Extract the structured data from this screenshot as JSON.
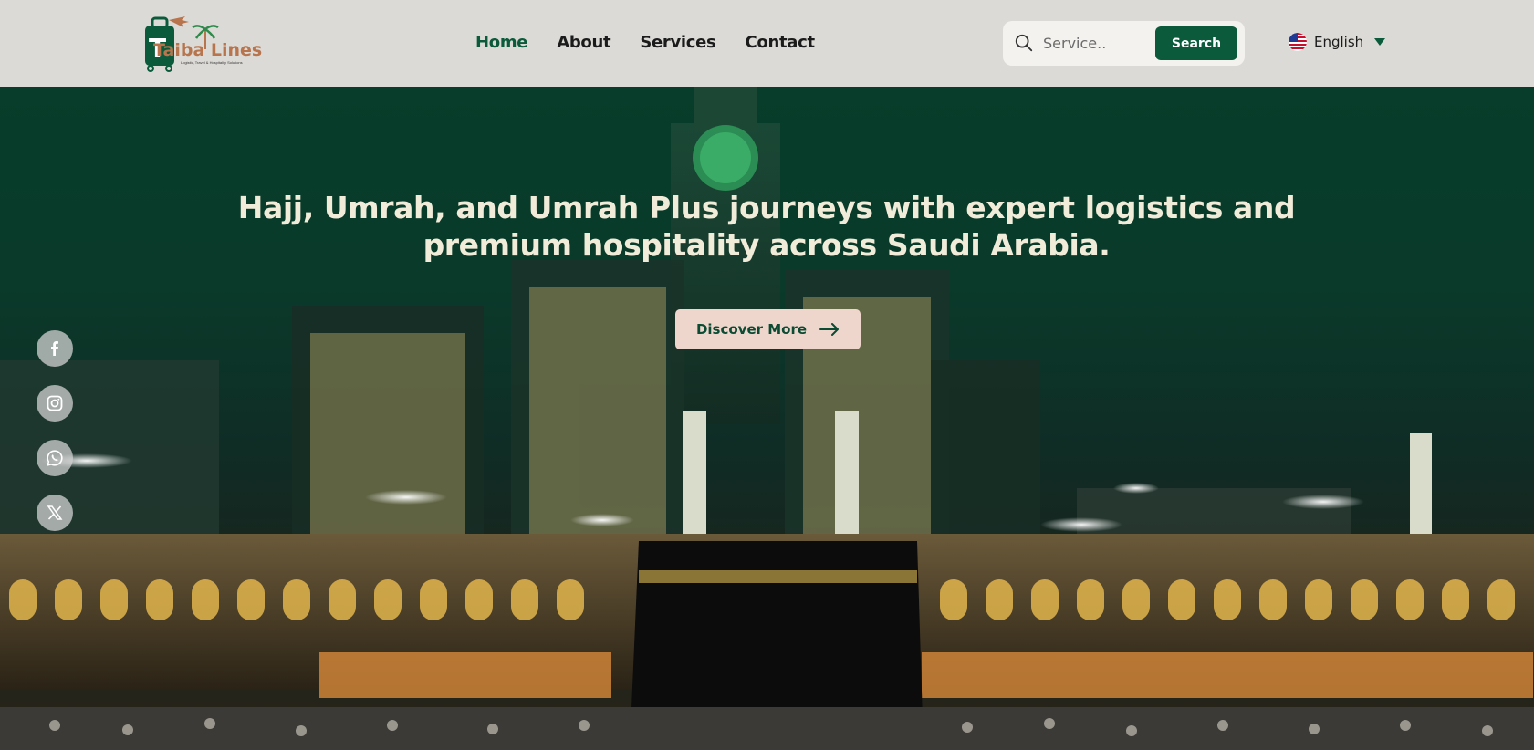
{
  "brand": {
    "name": "Taiba Lines",
    "tagline": "Logistic, Travel & Hospitality Solutions"
  },
  "nav": {
    "items": [
      {
        "label": "Home",
        "active": true
      },
      {
        "label": "About",
        "active": false
      },
      {
        "label": "Services",
        "active": false
      },
      {
        "label": "Contact",
        "active": false
      }
    ]
  },
  "search": {
    "placeholder": "Service..",
    "value": "",
    "button_label": "Search"
  },
  "language": {
    "selected": "English",
    "flag_icon": "us-flag-icon"
  },
  "hero": {
    "title_line1": "Hajj, Umrah, and Umrah Plus journeys with expert logistics and",
    "title_line2": "premium hospitality across Saudi Arabia.",
    "cta_label": "Discover More"
  },
  "social": [
    "facebook-icon",
    "instagram-icon",
    "whatsapp-icon",
    "x-twitter-icon"
  ],
  "colors": {
    "brand_green": "#0b5a3c",
    "header_bg": "#dcdad6",
    "cta_bg": "#efd6cc",
    "logo_brown": "#b8754d"
  }
}
